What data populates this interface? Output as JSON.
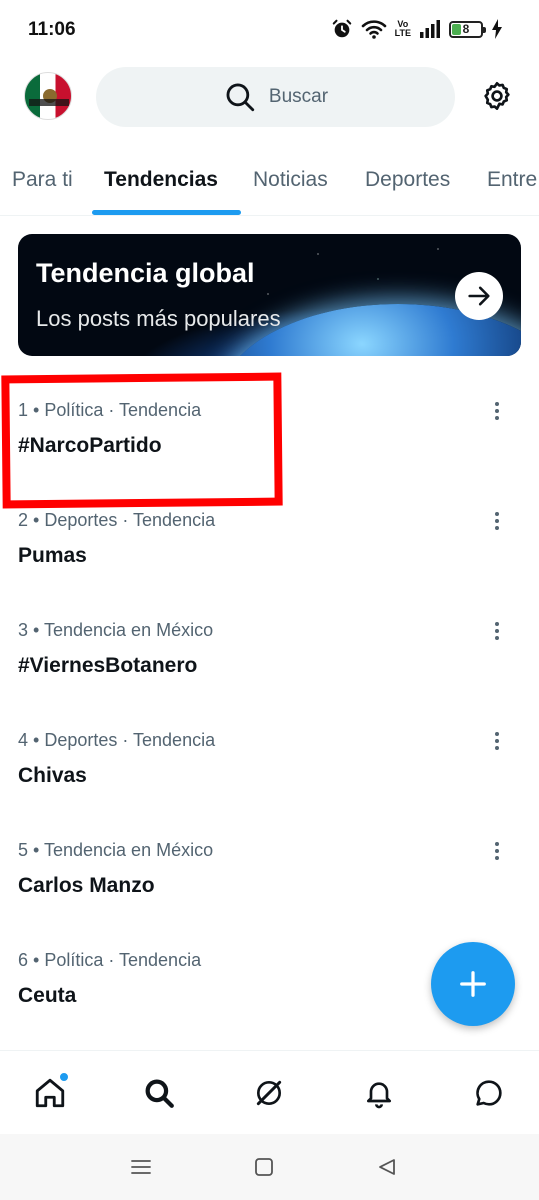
{
  "status_bar": {
    "time": "11:06",
    "volte_top": "Vo",
    "volte_bottom": "LTE",
    "battery_level": "8",
    "battery_color": "#4caf50"
  },
  "header": {
    "avatar_icon": "profile-avatar-mexico-flag",
    "search_placeholder": "Buscar",
    "settings_icon": "gear-icon"
  },
  "tabs": [
    {
      "label": "Para ti",
      "active": false
    },
    {
      "label": "Tendencias",
      "active": true
    },
    {
      "label": "Noticias",
      "active": false
    },
    {
      "label": "Deportes",
      "active": false
    },
    {
      "label": "Entre",
      "active": false
    }
  ],
  "banner": {
    "title": "Tendencia global",
    "subtitle": "Los posts más populares",
    "button_icon": "arrow-right-icon"
  },
  "trends": [
    {
      "meta": "1 • Política · Tendencia",
      "name": "#NarcoPartido"
    },
    {
      "meta": "2 • Deportes · Tendencia",
      "name": "Pumas"
    },
    {
      "meta": "3 • Tendencia en México",
      "name": "#ViernesBotanero"
    },
    {
      "meta": "4 • Deportes · Tendencia",
      "name": "Chivas"
    },
    {
      "meta": "5 • Tendencia en México",
      "name": "Carlos Manzo"
    },
    {
      "meta": "6 • Política · Tendencia",
      "name": "Ceuta"
    }
  ],
  "annotation": {
    "highlight_color": "#ff0000",
    "highlighted_trend": 1
  },
  "fab": {
    "icon": "plus-icon",
    "color": "#1d9bf0"
  },
  "bottom_nav": [
    {
      "icon": "home-icon",
      "has_notification_dot": true
    },
    {
      "icon": "search-icon",
      "active": true
    },
    {
      "icon": "grok-icon"
    },
    {
      "icon": "bell-icon"
    },
    {
      "icon": "messages-icon"
    }
  ],
  "system_nav": [
    "menu-icon",
    "home-square-icon",
    "back-triangle-icon"
  ],
  "colors": {
    "accent": "#1d9bf0",
    "secondary_text": "#536471",
    "primary_text": "#0f1419"
  }
}
